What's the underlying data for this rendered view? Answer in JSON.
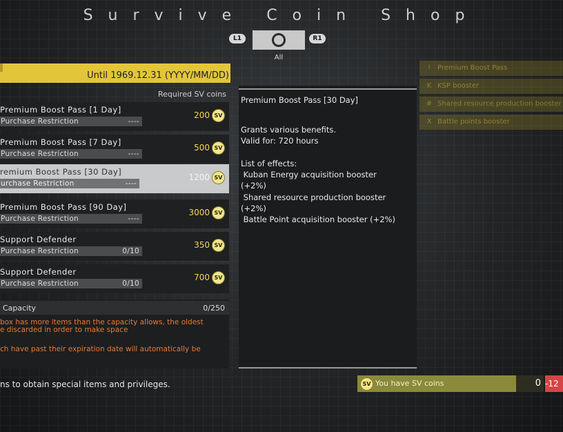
{
  "header": {
    "title": "Survive Coin Shop",
    "l1": "L1",
    "r1": "R1",
    "active_tab": "All"
  },
  "left": {
    "until": "Until 1969.12.31 (YYYY/MM/DD)",
    "required_header": "Required SV  coins",
    "items": [
      {
        "name": "Premium Boost Pass [1 Day]",
        "restriction_label": "Purchase Restriction",
        "restriction_value": "----",
        "price": "200"
      },
      {
        "name": "Premium Boost Pass [7 Day]",
        "restriction_label": "Purchase Restriction",
        "restriction_value": "----",
        "price": "500"
      },
      {
        "name": "remium Boost Pass [30 Day]",
        "restriction_label": "urchase Restriction",
        "restriction_value": "----",
        "price": "1200"
      },
      {
        "name": "Premium Boost Pass [90 Day]",
        "restriction_label": "Purchase Restriction",
        "restriction_value": "----",
        "price": "3000"
      },
      {
        "name": "Support Defender",
        "restriction_label": "Purchase Restriction",
        "restriction_value": "0/10",
        "price": "350"
      },
      {
        "name": "Support Defender",
        "restriction_label": "Purchase Restriction",
        "restriction_value": "0/10",
        "price": "700"
      }
    ],
    "coin_symbol": "SV",
    "capacity_label": " Capacity",
    "capacity_value": "0/250",
    "warning1": "box has more items than the capacity allows, the oldest\ne discarded in order to make space",
    "warning2": "ch have past their expiration date will automatically be",
    "footer": "ns to obtain special items and privileges."
  },
  "detail": {
    "title": "Premium Boost Pass [30 Day]",
    "body": "Grants various benefits.\nValid for: 720 hours\n\nList of effects:\n Kuban Energy acquisition booster\n(+2%)\n Shared resource production booster\n(+2%)\n Battle Point acquisition booster (+2%)"
  },
  "right_list": [
    {
      "icon": "!",
      "label": "Premium Boost Pass"
    },
    {
      "icon": "K",
      "label": "KSP booster"
    },
    {
      "icon": "#",
      "label": "Shared resource production booster"
    },
    {
      "icon": "X",
      "label": "Battle points booster"
    }
  ],
  "wallet": {
    "label": "You have SV  coins",
    "value": "0",
    "deficit": "-12"
  }
}
